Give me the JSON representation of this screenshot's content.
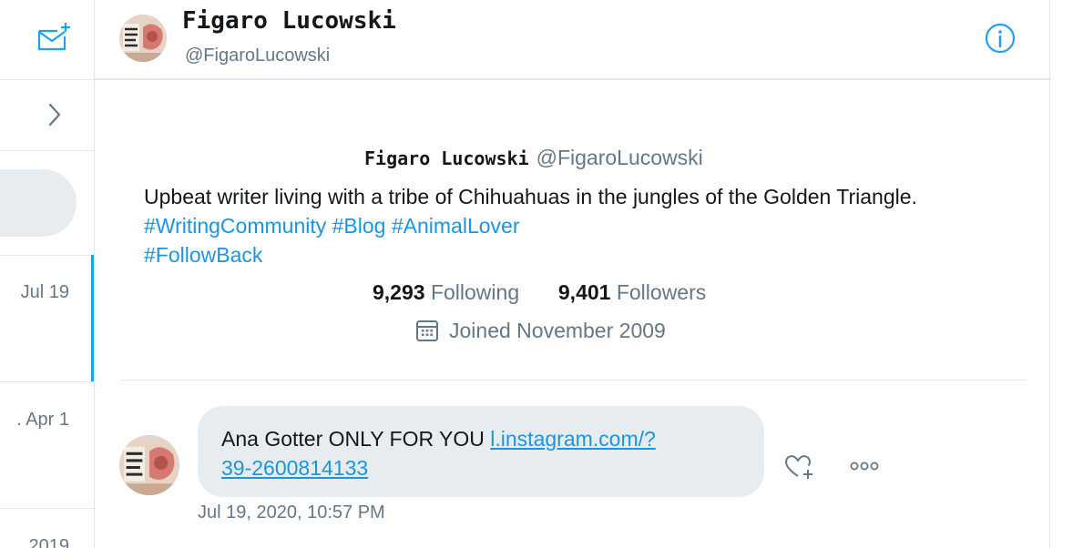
{
  "conversation_list": {
    "compose_icon": "new-message-icon",
    "requests_chevron": "chevron-right-icon",
    "items": [
      {
        "date": "Jul 19"
      },
      {
        "date": ". Apr 1"
      },
      {
        "date": "2019"
      }
    ]
  },
  "header": {
    "name": "Figaro Lucowski",
    "handle": "@FigaroLucowski",
    "info_icon": "info-icon"
  },
  "profile": {
    "name": "Figaro Lucowski",
    "handle": "@FigaroLucowski",
    "bio_text": "Upbeat writer living with a tribe of Chihuahuas in the jungles of the Golden Triangle.",
    "hashtags": [
      "#WritingCommunity",
      "#Blog",
      "#AnimalLover",
      "#FollowBack"
    ],
    "following_count": "9,293",
    "following_label": "Following",
    "followers_count": "9,401",
    "followers_label": "Followers",
    "joined": "Joined November 2009"
  },
  "message": {
    "text": "Ana Gotter ONLY FOR YOU",
    "link_line1": "l.instagram.com/?",
    "link_line2": "39-2600814133",
    "timestamp": "Jul 19, 2020, 10:57 PM"
  },
  "colors": {
    "accent": "#1da1f2",
    "link": "#1b95e0",
    "bubble": "#e6ecf0",
    "secondary_text": "#657786"
  }
}
